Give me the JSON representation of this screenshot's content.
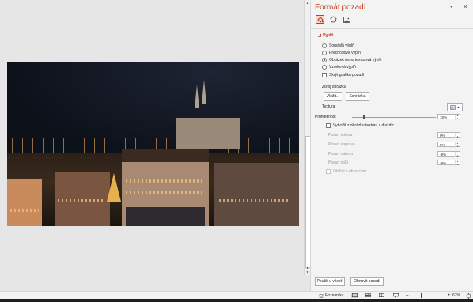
{
  "pane": {
    "title": "Formát pozadí",
    "section": "Výplň",
    "fill_options": [
      {
        "label": "Souvislá výplň",
        "selected": false
      },
      {
        "label": "Přechodová výplň",
        "selected": false
      },
      {
        "label": "Obrázek nebo texturová výplň",
        "selected": true
      },
      {
        "label": "Vzorková výplň",
        "selected": false
      }
    ],
    "hide_graphics_label": "Skrýt grafiku pozadí",
    "source_label": "Zdroj obrázku",
    "insert_button": "Vložit...",
    "clipboard_button": "Schránka",
    "texture_label": "Textura",
    "transparency_label": "Průhlednost",
    "transparency_value": "15%",
    "transparency_fraction": 0.15,
    "tile_label": "Vytvořit z obrázku texturu z dlaždic",
    "offsets": [
      {
        "label": "Posun doleva",
        "value": "0%"
      },
      {
        "label": "Posun doprava",
        "value": "0%"
      },
      {
        "label": "Posun nahoru",
        "value": "-9%"
      },
      {
        "label": "Posun dolů",
        "value": "-9%"
      }
    ],
    "rotate_label": "Otáčet s obrazcem",
    "apply_all_button": "Použít u všech",
    "reset_button": "Obnovit pozadí"
  },
  "statusbar": {
    "notes_label": "Poznámky",
    "zoom_level": "67%"
  },
  "colors": {
    "accent": "#c43e1c",
    "pane_bg": "#f3f3f3",
    "canvas_bg": "#e6e6e6"
  },
  "icons": [
    "fill-effects-icon",
    "effects-pentagon-icon",
    "picture-icon",
    "close-icon",
    "notes-icon",
    "normal-view-icon",
    "slide-sorter-icon",
    "reading-view-icon",
    "slideshow-icon",
    "fit-slide-icon"
  ]
}
